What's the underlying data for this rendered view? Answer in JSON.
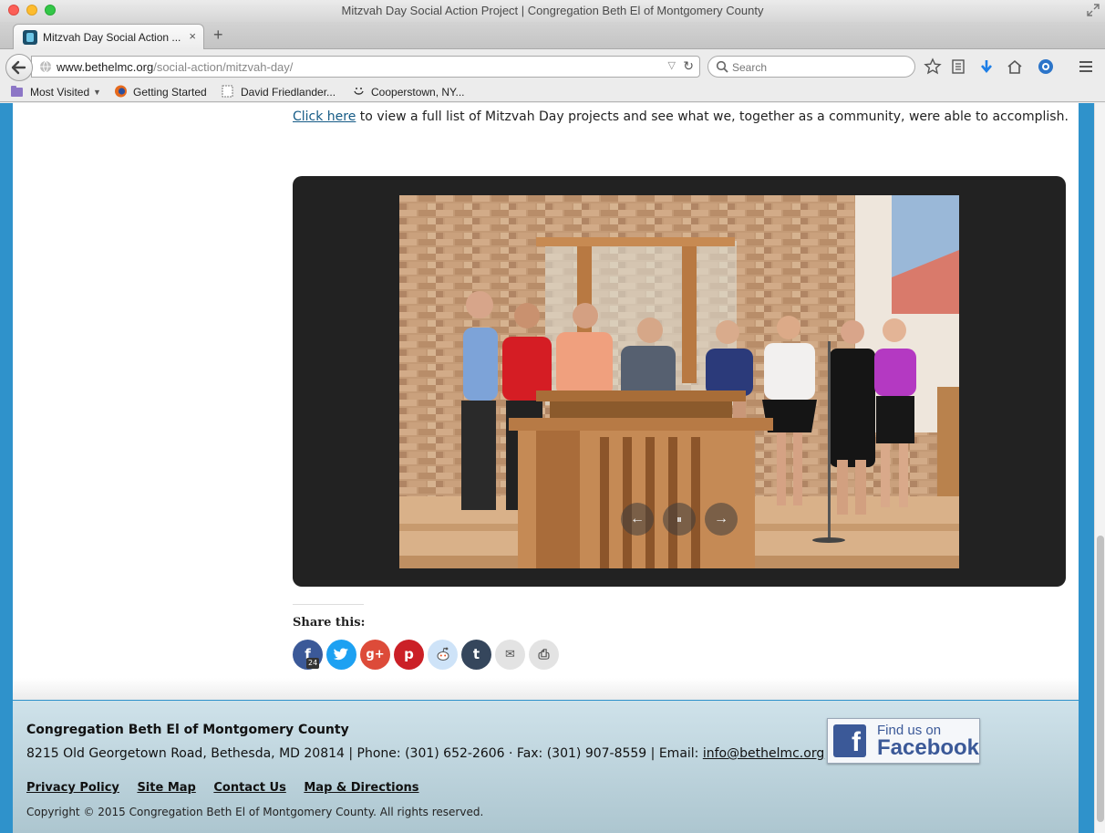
{
  "window": {
    "title": "Mitzvah Day Social Action Project | Congregation Beth El of Montgomery County"
  },
  "tab": {
    "label": "Mitzvah Day Social Action ...",
    "close": "×",
    "new": "+"
  },
  "url": {
    "host": "www.bethelmc.org",
    "path": "/social-action/mitzvah-day/"
  },
  "search": {
    "placeholder": "Search"
  },
  "bookmarks": [
    {
      "label": "Most Visited",
      "icon": "folder-icon"
    },
    {
      "label": "Getting Started",
      "icon": "firefox-icon"
    },
    {
      "label": "David Friedlander...",
      "icon": "page-icon"
    },
    {
      "label": "Cooperstown, NY...",
      "icon": "smiley-icon"
    }
  ],
  "content": {
    "intro_link": "Click here",
    "intro_rest": " to view a full list of Mitzvah Day projects and see what we, together as a community, were able to accomplish."
  },
  "slideshow": {
    "prev": "←",
    "pause": "⏸",
    "next": "→"
  },
  "share": {
    "title": "Share this:",
    "buttons": [
      {
        "name": "facebook",
        "glyph": "f",
        "color": "#3b5998",
        "count": "24"
      },
      {
        "name": "twitter",
        "glyph": "t",
        "color": "#1da1f2"
      },
      {
        "name": "google-plus",
        "glyph": "g+",
        "color": "#dd4b39"
      },
      {
        "name": "pinterest",
        "glyph": "p",
        "color": "#cb2027"
      },
      {
        "name": "reddit",
        "glyph": "r",
        "color": "#cee3f8"
      },
      {
        "name": "tumblr",
        "glyph": "t",
        "color": "#35465c"
      },
      {
        "name": "email",
        "glyph": "✉",
        "color": "#e3e3e3"
      },
      {
        "name": "print",
        "glyph": "⎙",
        "color": "#e3e3e3"
      }
    ]
  },
  "footer": {
    "org": "Congregation Beth El of Montgomery County",
    "address": "8215 Old Georgetown Road, Bethesda, MD 20814 | Phone: (301) 652-2606 · Fax: (301) 907-8559 | Email: ",
    "email": "info@bethelmc.org",
    "links": [
      "Privacy Policy",
      "Site Map",
      "Contact Us",
      "Map & Directions"
    ],
    "copyright": "Copyright © 2015 Congregation Beth El of Montgomery County. All rights reserved.",
    "facebook_find": "Find us on",
    "facebook_name": "Facebook",
    "facebook_logo": "f"
  }
}
